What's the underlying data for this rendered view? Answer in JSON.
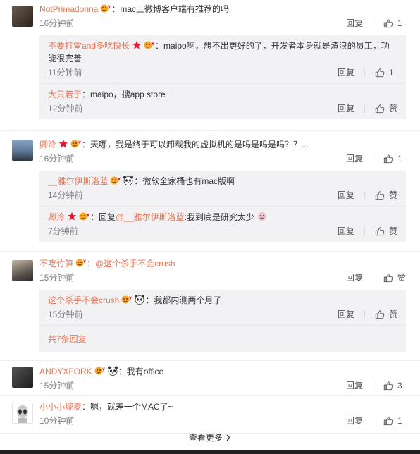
{
  "comments": [
    {
      "user": "NotPrimadonna",
      "text": "：mac上微博客户端有推荐的吗",
      "time": "16分钟前",
      "reply_label": "回复",
      "like_count": "1",
      "subs": [
        {
          "user": "不要打雷and多吃快长",
          "text": "：maipo啊，想不出更好的了，开发者本身就是渣浪的员工，功能很完善",
          "time": "11分钟前",
          "reply_label": "回复",
          "like_count": "1"
        },
        {
          "user": "大只若于",
          "text": "：maipo，搜app store",
          "time": "12分钟前",
          "reply_label": "回复",
          "like_count": "赞"
        }
      ]
    },
    {
      "user": "卿泠",
      "text": "：天哪，我是终于可以卸载我的虚拟机的是吗是吗是吗？？...",
      "time": "16分钟前",
      "reply_label": "回复",
      "like_count": "1",
      "subs": [
        {
          "user": "__雅尔伊斯洛蓝",
          "text": "：微软全家桶也有mac版啊",
          "time": "14分钟前",
          "reply_label": "回复",
          "like_count": "赞"
        },
        {
          "user": "卿泠",
          "text_prefix": "：回复",
          "at": "@__雅尔伊斯洛蓝",
          "text": ":我到底是研究太少",
          "time": "7分钟前",
          "reply_label": "回复",
          "like_count": "赞"
        }
      ]
    },
    {
      "user": "不吃竹笋",
      "text_prefix": "：",
      "at": "@这个杀手不会crush",
      "time": "15分钟前",
      "reply_label": "回复",
      "like_count": "赞",
      "subs": [
        {
          "user": "这个杀手不会crush",
          "text": "：我都内测两个月了",
          "time": "15分钟前",
          "reply_label": "回复",
          "like_count": "赞"
        }
      ],
      "more_replies": "共7条回复"
    },
    {
      "user": "ANDYXFORK",
      "text": "：我有office",
      "time": "15分钟前",
      "reply_label": "回复",
      "like_count": "3"
    },
    {
      "user": "小小小烧麦",
      "text": "：嗯，就差一个MAC了~",
      "time": "10分钟前",
      "reply_label": "回复",
      "like_count": "1"
    }
  ],
  "view_more": "查看更多",
  "colors": {
    "accent": "#eb7350",
    "sub_bg": "#f2f2f5"
  }
}
